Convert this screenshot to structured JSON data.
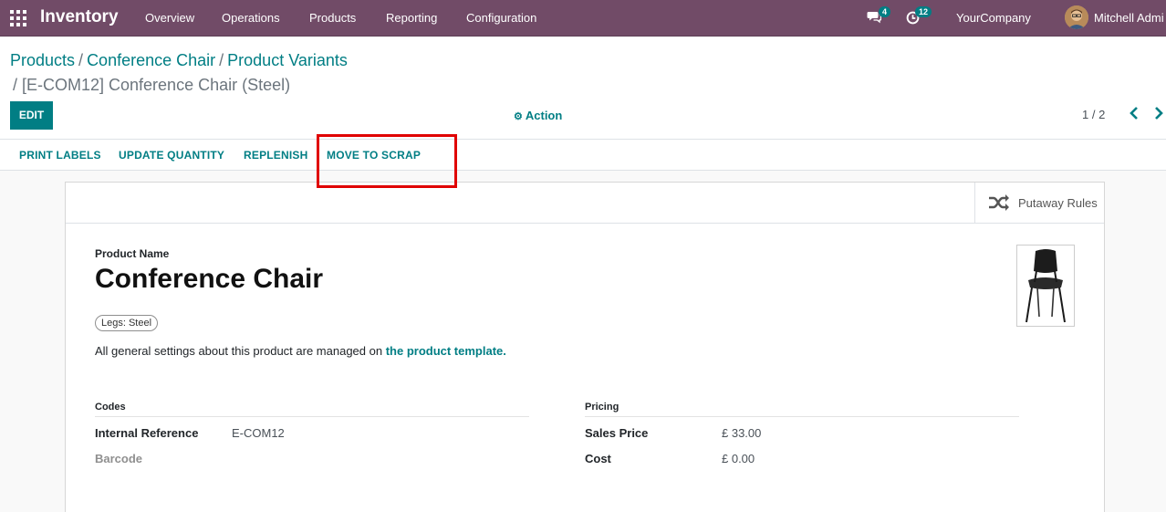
{
  "navbar": {
    "app_name": "Inventory",
    "menu": [
      "Overview",
      "Operations",
      "Products",
      "Reporting",
      "Configuration"
    ],
    "messages_count": "4",
    "activities_count": "12",
    "company": "YourCompany",
    "user": "Mitchell Admi"
  },
  "breadcrumb": {
    "items": [
      "Products",
      "Conference Chair",
      "Product Variants"
    ],
    "separator": "/",
    "active": "/ [E-COM12] Conference Chair (Steel)"
  },
  "control": {
    "edit_label": "EDIT",
    "action_label": "Action",
    "pager": "1 / 2"
  },
  "buttons": [
    "PRINT LABELS",
    "UPDATE QUANTITY",
    "REPLENISH",
    "MOVE TO SCRAP"
  ],
  "smart_button": {
    "label": "Putaway Rules",
    "icon": "shuffle-icon"
  },
  "form": {
    "name_label": "Product Name",
    "name": "Conference Chair",
    "attribute_tag": "Legs: Steel",
    "note_text": "All general settings about this product are managed on ",
    "note_link": "the product template.",
    "codes": {
      "title": "Codes",
      "internal_reference_label": "Internal Reference",
      "internal_reference": "E-COM12",
      "barcode_label": "Barcode"
    },
    "pricing": {
      "title": "Pricing",
      "sales_price_label": "Sales Price",
      "sales_price": "£ 33.00",
      "cost_label": "Cost",
      "cost": "£ 0.00"
    }
  },
  "colors": {
    "navbar": "#714b67",
    "accent": "#017e84",
    "highlight": "#e00000"
  }
}
